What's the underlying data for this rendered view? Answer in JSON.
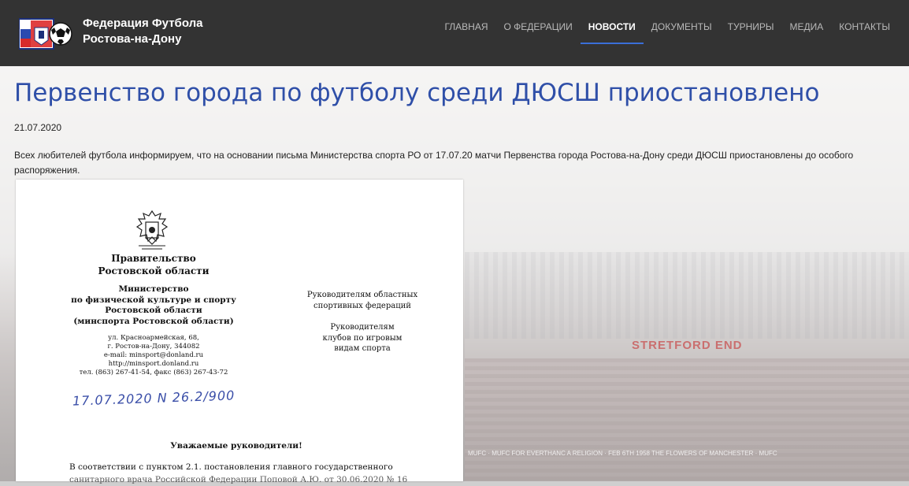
{
  "header": {
    "brand_line1": "Федерация Футбола",
    "brand_line2": "Ростова-на-Дону",
    "nav": [
      {
        "label": "ГЛАВНАЯ",
        "active": false
      },
      {
        "label": "О ФЕДЕРАЦИИ",
        "active": false
      },
      {
        "label": "НОВОСТИ",
        "active": true
      },
      {
        "label": "ДОКУМЕНТЫ",
        "active": false
      },
      {
        "label": "ТУРНИРЫ",
        "active": false
      },
      {
        "label": "МЕДИА",
        "active": false
      },
      {
        "label": "КОНТАКТЫ",
        "active": false
      }
    ],
    "colors": {
      "bar": "#333333",
      "active_underline": "#3a6fd8"
    }
  },
  "background": {
    "stand_sign": "STRETFORD END",
    "banner_text": "MUFC · MUFC FOR EVERTHANC A RELIGION · FEB 6TH 1958 THE FLOWERS OF MANCHESTER · MUFC"
  },
  "article": {
    "title": "Первенство города по футболу среди ДЮСШ приостановлено",
    "date": "21.07.2020",
    "lead": "Всех любителей футбола информируем, что на основании письма Министерства спорта РО от 17.07.20 матчи Первенства города Ростова-на-Дону среди ДЮСШ приостановлены до особого распоряжения.",
    "title_color": "#2f4fa8"
  },
  "letter": {
    "gov_line1": "Правительство",
    "gov_line2": "Ростовской области",
    "ministry_line1": "Министерство",
    "ministry_line2": "по физической культуре и спорту",
    "ministry_line3": "Ростовской области",
    "ministry_line4": "(минспорта Ростовской области)",
    "address_line1": "ул. Красноармейская, 68,",
    "address_line2": "г. Ростов-на-Дону, 344082",
    "address_line3": "e-mail: minsport@donland.ru",
    "address_line4": "http://minsport.donland.ru",
    "address_line5": "тел. (863) 267-41-54, факс (863) 267-43-72",
    "handwritten_ref": "17.07.2020 N 26.2/900",
    "recipient1_line1": "Руководителям областных",
    "recipient1_line2": "спортивных федераций",
    "recipient2_line1": "Руководителям",
    "recipient2_line2": "клубов по игровым",
    "recipient2_line3": "видам спорта",
    "greeting": "Уважаемые руководители!",
    "body_start": "В соответствии с пунктом 2.1. постановления главного государственного",
    "body_next": "санитарного врача Российской Федерации Поповой А.Ю. от 30.06.2020 № 16"
  }
}
